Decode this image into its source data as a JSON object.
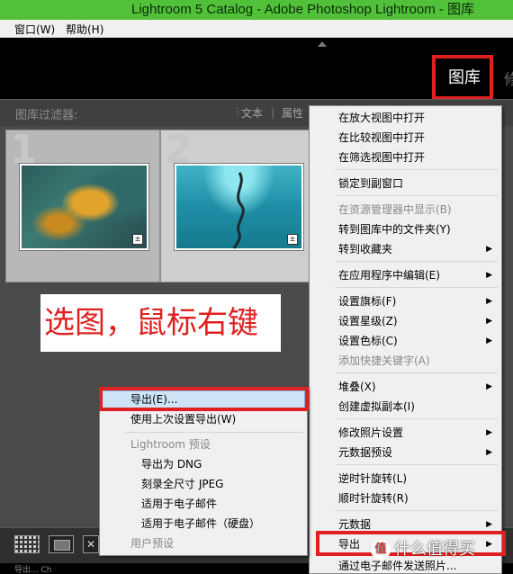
{
  "window": {
    "title": "Lightroom 5 Catalog - Adobe Photoshop Lightroom - 图库"
  },
  "menubar": {
    "window": "窗口(W)",
    "help": "帮助(H)"
  },
  "modules": {
    "library": "图库",
    "next_partial": "修"
  },
  "filter": {
    "label": "图库过滤器:",
    "text": "文本",
    "attribute": "属性"
  },
  "grid": {
    "cells": [
      {
        "index": "1"
      },
      {
        "index": "2"
      }
    ]
  },
  "annotation": {
    "text": "选图，鼠标右键"
  },
  "status": {
    "text": "导出...  Ch"
  },
  "context_menu": {
    "items": [
      {
        "label": "在放大视图中打开",
        "disabled": false,
        "sub": false
      },
      {
        "label": "在比较视图中打开",
        "disabled": false,
        "sub": false
      },
      {
        "label": "在筛选视图中打开",
        "disabled": false,
        "sub": false
      },
      {
        "label": "锁定到副窗口",
        "disabled": false,
        "sub": false
      },
      {
        "label": "在资源管理器中显示(B)",
        "disabled": true,
        "sub": false
      },
      {
        "label": "转到图库中的文件夹(Y)",
        "disabled": false,
        "sub": false
      },
      {
        "label": "转到收藏夹",
        "disabled": false,
        "sub": true
      },
      {
        "label": "在应用程序中编辑(E)",
        "disabled": false,
        "sub": true
      },
      {
        "label": "设置旗标(F)",
        "disabled": false,
        "sub": true
      },
      {
        "label": "设置星级(Z)",
        "disabled": false,
        "sub": true
      },
      {
        "label": "设置色标(C)",
        "disabled": false,
        "sub": true
      },
      {
        "label": "添加快捷关键字(A)",
        "disabled": true,
        "sub": false
      },
      {
        "label": "堆叠(X)",
        "disabled": false,
        "sub": true
      },
      {
        "label": "创建虚拟副本(I)",
        "disabled": false,
        "sub": false
      },
      {
        "label": "修改照片设置",
        "disabled": false,
        "sub": true
      },
      {
        "label": "元数据预设",
        "disabled": false,
        "sub": true
      },
      {
        "label": "逆时针旋转(L)",
        "disabled": false,
        "sub": false
      },
      {
        "label": "顺时针旋转(R)",
        "disabled": false,
        "sub": false
      },
      {
        "label": "元数据",
        "disabled": false,
        "sub": true
      },
      {
        "label": "导出",
        "disabled": false,
        "sub": true
      },
      {
        "label": "通过电子邮件发送照片...",
        "disabled": false,
        "sub": false
      }
    ]
  },
  "export_submenu": {
    "items": [
      {
        "label": "导出(E)...",
        "disabled": false
      },
      {
        "label": "使用上次设置导出(W)",
        "disabled": false
      },
      {
        "label": "Lightroom 预设",
        "disabled": true
      },
      {
        "label": "导出为 DNG",
        "disabled": false
      },
      {
        "label": "刻录全尺寸 JPEG",
        "disabled": false
      },
      {
        "label": "适用于电子邮件",
        "disabled": false
      },
      {
        "label": "适用于电子邮件（硬盘）",
        "disabled": false
      },
      {
        "label": "用户预设",
        "disabled": true
      }
    ]
  },
  "watermark": {
    "badge": "值",
    "text": "什么值得买"
  }
}
